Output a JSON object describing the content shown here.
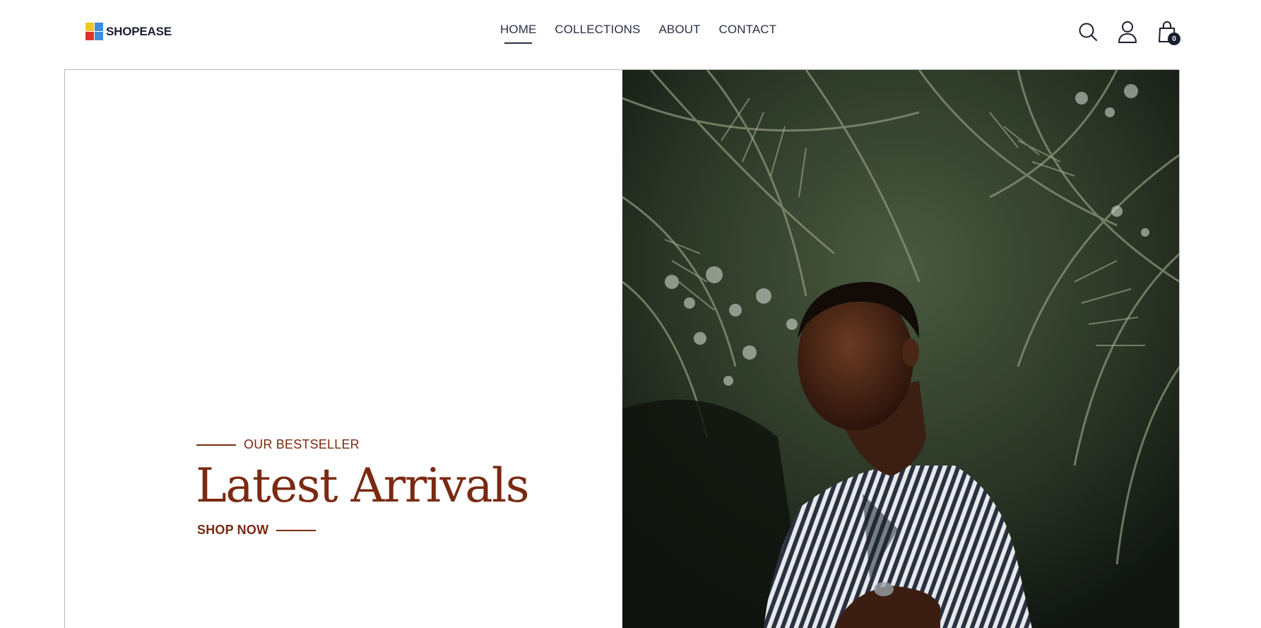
{
  "brand": {
    "name": "SHOPEASE",
    "logo_colors": [
      "#f2c81d",
      "#3a8fe0",
      "#e2322d",
      "#3a8fe0"
    ]
  },
  "nav": {
    "items": [
      {
        "label": "HOME",
        "active": true
      },
      {
        "label": "COLLECTIONS",
        "active": false
      },
      {
        "label": "ABOUT",
        "active": false
      },
      {
        "label": "CONTACT",
        "active": false
      }
    ]
  },
  "header_icons": {
    "search": "search-icon",
    "account": "user-icon",
    "cart": "shopping-bag-icon",
    "cart_count": "0"
  },
  "hero": {
    "eyebrow": "OUR BESTSELLER",
    "title": "Latest Arrivals",
    "cta": "SHOP NOW",
    "image": "photo of a man in a striped shirt in front of palm leaves",
    "accent_color": "#7a2a12"
  }
}
